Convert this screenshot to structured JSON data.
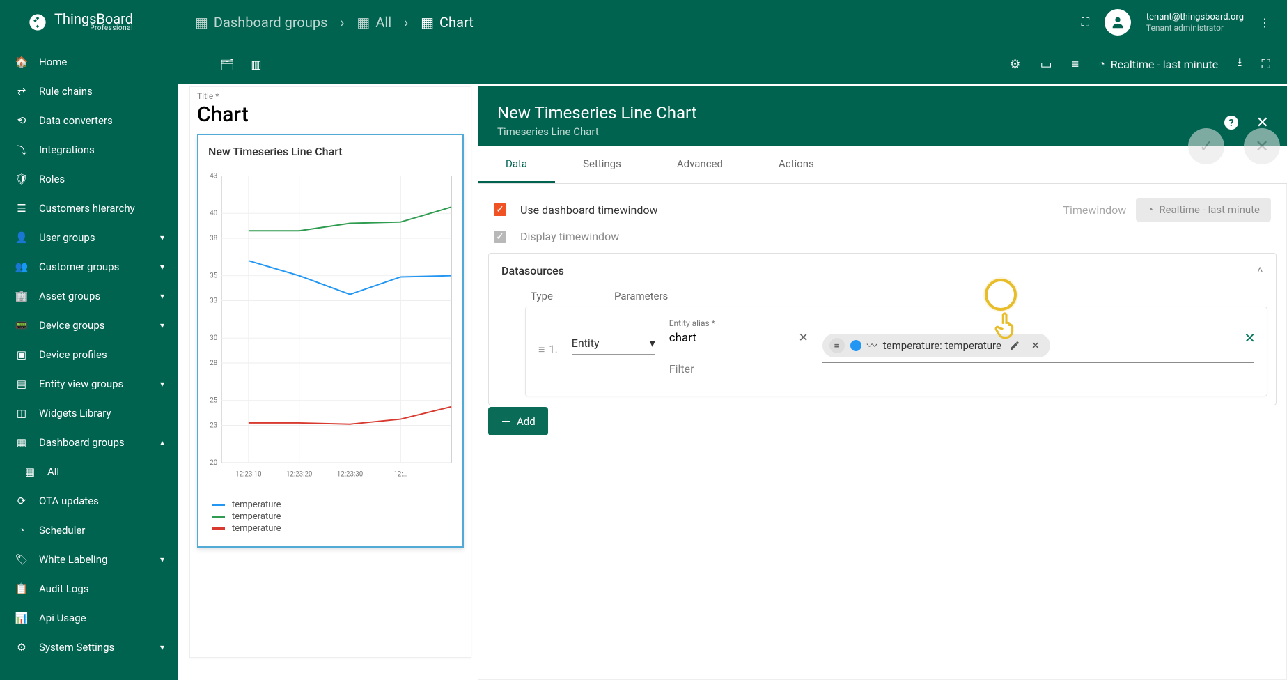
{
  "brand": {
    "name": "ThingsBoard",
    "edition": "Professional"
  },
  "user": {
    "email": "tenant@thingsboard.org",
    "role": "Tenant administrator"
  },
  "breadcrumbs": {
    "b1": "Dashboard groups",
    "b2": "All",
    "b3": "Chart"
  },
  "toolbar": {
    "timewindow": "Realtime - last minute"
  },
  "sidebar": {
    "items": [
      {
        "label": "Home"
      },
      {
        "label": "Rule chains"
      },
      {
        "label": "Data converters"
      },
      {
        "label": "Integrations"
      },
      {
        "label": "Roles"
      },
      {
        "label": "Customers hierarchy"
      },
      {
        "label": "User groups"
      },
      {
        "label": "Customer groups"
      },
      {
        "label": "Asset groups"
      },
      {
        "label": "Device groups"
      },
      {
        "label": "Device profiles"
      },
      {
        "label": "Entity view groups"
      },
      {
        "label": "Widgets Library"
      },
      {
        "label": "Dashboard groups"
      },
      {
        "label": "All"
      },
      {
        "label": "OTA updates"
      },
      {
        "label": "Scheduler"
      },
      {
        "label": "White Labeling"
      },
      {
        "label": "Audit Logs"
      },
      {
        "label": "Api Usage"
      },
      {
        "label": "System Settings"
      }
    ]
  },
  "title_card": {
    "label": "Title *",
    "value": "Chart"
  },
  "chart": {
    "title": "New Timeseries Line Chart"
  },
  "chart_data": {
    "type": "line",
    "title": "New Timeseries Line Chart",
    "xlabel": "",
    "ylabel": "",
    "ylim": [
      20,
      43
    ],
    "y_ticks": [
      20,
      23,
      25,
      28,
      30,
      33,
      35,
      38,
      40,
      43
    ],
    "x_ticks": [
      "12:23:10",
      "12:23:20",
      "12:23:30",
      "12:…"
    ],
    "series": [
      {
        "name": "temperature",
        "color": "#2196f3",
        "values": [
          36.2,
          35.0,
          33.5,
          34.9,
          35.0
        ]
      },
      {
        "name": "temperature",
        "color": "#2e9b4f",
        "values": [
          38.6,
          38.6,
          39.2,
          39.3,
          40.5
        ]
      },
      {
        "name": "temperature",
        "color": "#d83a2f",
        "values": [
          23.2,
          23.2,
          23.1,
          23.5,
          24.5
        ]
      }
    ]
  },
  "editor": {
    "title": "New Timeseries Line Chart",
    "subtitle": "Timeseries Line Chart",
    "tabs": {
      "t0": "Data",
      "t1": "Settings",
      "t2": "Advanced",
      "t3": "Actions"
    },
    "use_tw": "Use dashboard timewindow",
    "display_tw": "Display timewindow",
    "tw_label": "Timewindow",
    "tw_value": "Realtime - last minute",
    "datasources": "Datasources",
    "col_type": "Type",
    "col_params": "Parameters",
    "row_index": "1.",
    "type_value": "Entity",
    "alias_label": "Entity alias *",
    "alias_value": "chart",
    "filter_placeholder": "Filter",
    "chip_text": "temperature: temperature",
    "add_label": "Add"
  }
}
